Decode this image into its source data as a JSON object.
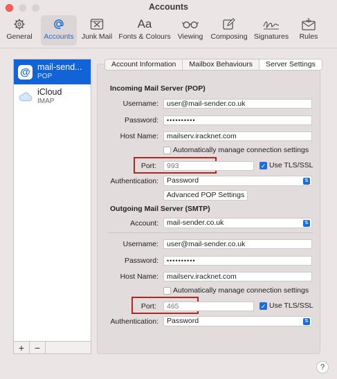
{
  "window": {
    "title": "Accounts"
  },
  "toolbar": {
    "items": [
      {
        "label": "General",
        "icon": "gear-icon"
      },
      {
        "label": "Accounts",
        "icon": "at-icon"
      },
      {
        "label": "Junk Mail",
        "icon": "junk-mail-icon"
      },
      {
        "label": "Fonts & Colours",
        "icon": "fonts-icon",
        "glyph": "Aa"
      },
      {
        "label": "Viewing",
        "icon": "glasses-icon"
      },
      {
        "label": "Composing",
        "icon": "compose-icon"
      },
      {
        "label": "Signatures",
        "icon": "signature-icon"
      },
      {
        "label": "Rules",
        "icon": "rules-icon"
      }
    ],
    "active": "Accounts"
  },
  "accounts": [
    {
      "name": "mail-send...",
      "type": "POP",
      "icon": "at-icon"
    },
    {
      "name": "iCloud",
      "type": "IMAP",
      "icon": "icloud-icon"
    }
  ],
  "list_footer": {
    "add": "+",
    "remove": "−"
  },
  "tabs": [
    "Account Information",
    "Mailbox Behaviours",
    "Server Settings"
  ],
  "active_tab": "Server Settings",
  "incoming": {
    "heading": "Incoming Mail Server (POP)",
    "username_label": "Username:",
    "username": "user@mail-sender.co.uk",
    "password_label": "Password:",
    "password": "••••••••••",
    "host_label": "Host Name:",
    "host": "mailserv.iracknet.com",
    "auto_manage": "Automatically manage connection settings",
    "port_label": "Port:",
    "port": "993",
    "tls": "Use TLS/SSL",
    "auth_label": "Authentication:",
    "auth": "Password",
    "advanced_button": "Advanced POP Settings"
  },
  "outgoing": {
    "heading": "Outgoing Mail Server (SMTP)",
    "account_label": "Account:",
    "account": "mail-sender.co.uk",
    "username_label": "Username:",
    "username": "user@mail-sender.co.uk",
    "password_label": "Password:",
    "password": "••••••••••",
    "host_label": "Host Name:",
    "host": "mailserv.iracknet.com",
    "auto_manage": "Automatically manage connection settings",
    "port_label": "Port:",
    "port": "465",
    "tls": "Use TLS/SSL",
    "auth_label": "Authentication:",
    "auth": "Password"
  },
  "help": "?",
  "colors": {
    "accent": "#1a6dde",
    "selection": "#1363d8",
    "highlight_box": "#b3261e",
    "close": "#fe5f57"
  }
}
